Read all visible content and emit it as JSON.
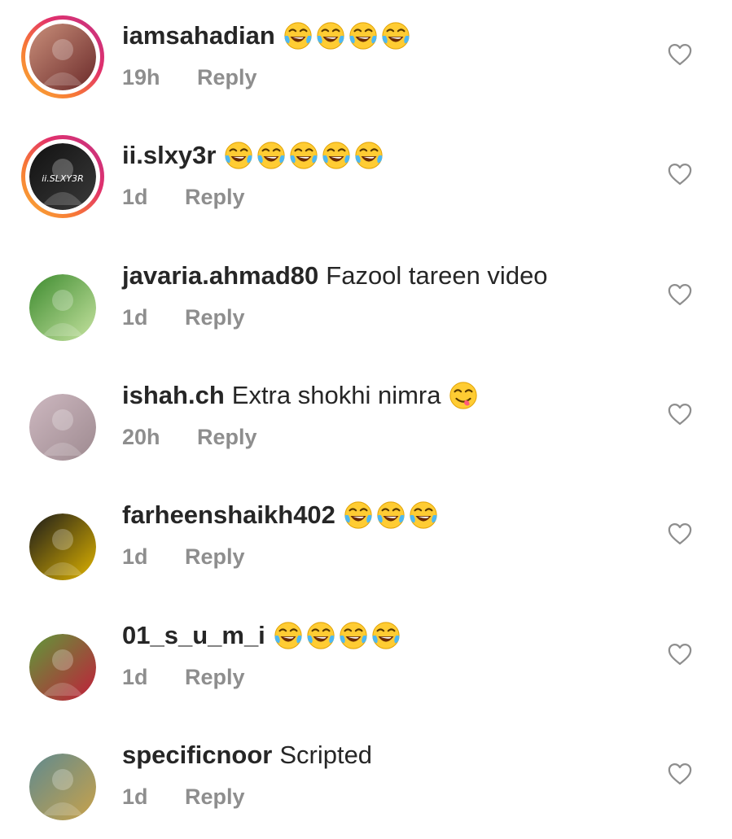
{
  "comments": [
    {
      "username": "iamsahadian",
      "text": "",
      "emoji_icons": [
        "face-with-tears-of-joy-icon",
        "face-with-tears-of-joy-icon",
        "face-with-tears-of-joy-icon",
        "face-with-tears-of-joy-icon"
      ],
      "time": "19h",
      "reply_label": "Reply",
      "story_ring": true,
      "avatar_colors": [
        "#c98f7a",
        "#6b2a2a"
      ]
    },
    {
      "username": "ii.slxy3r",
      "text": "",
      "emoji_icons": [
        "face-with-tears-of-joy-icon",
        "face-with-tears-of-joy-icon",
        "face-with-tears-of-joy-icon",
        "face-with-tears-of-joy-icon",
        "face-with-tears-of-joy-icon"
      ],
      "time": "1d",
      "reply_label": "Reply",
      "story_ring": true,
      "avatar_text": "ii.SLXY3R",
      "avatar_colors": [
        "#111111",
        "#3a3a3a"
      ]
    },
    {
      "username": "javaria.ahmad80",
      "text": "Fazool tareen video",
      "emoji_icons": [],
      "time": "1d",
      "reply_label": "Reply",
      "story_ring": false,
      "avatar_colors": [
        "#3d8b2f",
        "#c6e3a0"
      ]
    },
    {
      "username": "ishah.ch",
      "text": "Extra shokhi nimra",
      "emoji_icons": [
        "face-savoring-food-icon"
      ],
      "time": "20h",
      "reply_label": "Reply",
      "story_ring": false,
      "avatar_colors": [
        "#cdb8c0",
        "#9e8a90"
      ]
    },
    {
      "username": "farheenshaikh402",
      "text": "",
      "emoji_icons": [
        "face-with-tears-of-joy-icon",
        "face-with-tears-of-joy-icon",
        "face-with-tears-of-joy-icon"
      ],
      "time": "1d",
      "reply_label": "Reply",
      "story_ring": false,
      "avatar_colors": [
        "#1a1a1a",
        "#e0b400"
      ]
    },
    {
      "username": "01_s_u_m_i",
      "text": "",
      "emoji_icons": [
        "face-with-tears-of-joy-icon",
        "face-with-tears-of-joy-icon",
        "face-with-tears-of-joy-icon",
        "face-with-tears-of-joy-icon"
      ],
      "time": "1d",
      "reply_label": "Reply",
      "story_ring": false,
      "avatar_colors": [
        "#5e9a3a",
        "#c21e3a"
      ]
    },
    {
      "username": "specificnoor",
      "text": "Scripted",
      "emoji_icons": [],
      "time": "1d",
      "reply_label": "Reply",
      "story_ring": false,
      "avatar_colors": [
        "#5f8a8f",
        "#c9a24a"
      ]
    }
  ],
  "colors": {
    "text_primary": "#262626",
    "text_secondary": "#8e8e8e",
    "story_ring_gradient": [
      "#f9b233",
      "#e1306c",
      "#c13584"
    ],
    "heart_outline": "#8e8e8e"
  },
  "icons": {
    "like": "heart-outline-icon"
  }
}
